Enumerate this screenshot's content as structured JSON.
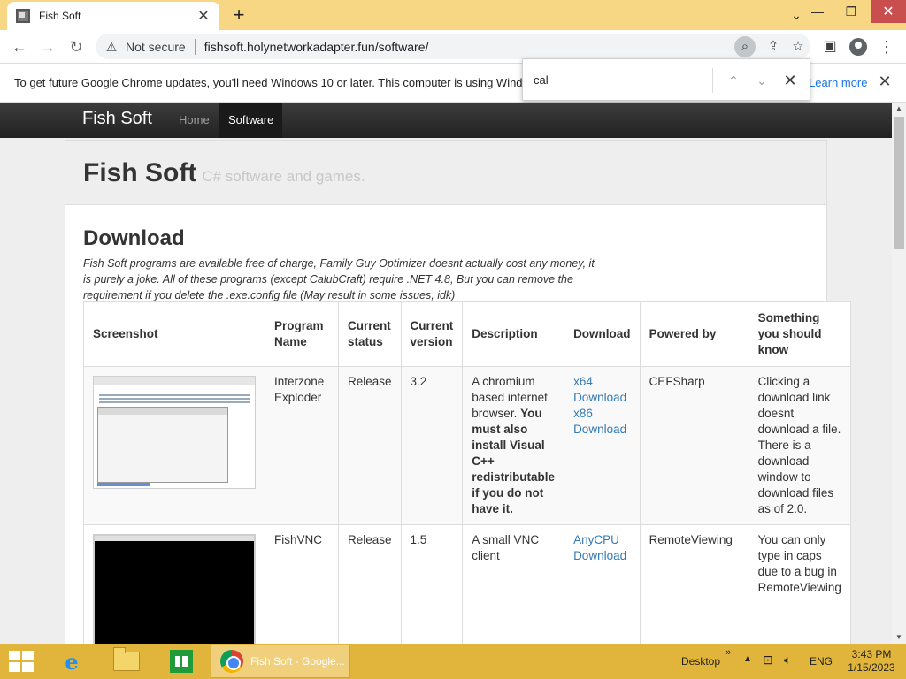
{
  "browser": {
    "tab_title": "Fish Soft",
    "tab_close": "✕",
    "new_tab": "+",
    "window_controls": {
      "dropdown": "⌄",
      "minimize": "—",
      "restore": "❐",
      "close": "✕"
    },
    "nav": {
      "back": "←",
      "forward": "→",
      "reload": "↻"
    },
    "security_label": "Not secure",
    "url": "fishsoft.holynetworkadapter.fun/software/",
    "infobar": {
      "text": "To get future Google Chrome updates, you'll need Windows 10 or later. This computer is using Windows 8.",
      "link": "Learn more"
    },
    "find": {
      "query": "cal",
      "prev": "⌃",
      "next": "⌄",
      "close": "✕"
    }
  },
  "site": {
    "brand": "Fish Soft",
    "nav": [
      {
        "label": "Home"
      },
      {
        "label": "Software"
      }
    ],
    "jumbo_title": "Fish Soft",
    "jumbo_subtitle": "C# software and games.",
    "section_title": "Download",
    "section_desc": "Fish Soft programs are available free of charge, Family Guy Optimizer doesnt actually cost any money, it is purely a joke. All of these programs (except CalubCraft) require .NET 4.8, But you can remove the requirement if you delete the .exe.config file (May result in some issues, idk)",
    "table": {
      "headers": [
        "Screenshot",
        "Program Name",
        "Current status",
        "Current version",
        "Description",
        "Download",
        "Powered by",
        "Something you should know"
      ],
      "rows": [
        {
          "name": "Interzone Exploder",
          "status": "Release",
          "version": "3.2",
          "desc_plain": "A chromium based internet browser.",
          "desc_bold": "You must also install Visual C++ redistributable if you do not have it.",
          "downloads": [
            "x64 Download",
            "x86 Download"
          ],
          "powered_by": "CEFSharp",
          "note": "Clicking a download link doesnt download a file. There is a download window to download files as of 2.0."
        },
        {
          "name": "FishVNC",
          "status": "Release",
          "version": "1.5",
          "desc_plain": "A small VNC client",
          "desc_bold": "",
          "downloads": [
            "AnyCPU Download"
          ],
          "powered_by": "RemoteViewing",
          "note": "You can only type in caps due to a bug in RemoteViewing"
        }
      ]
    }
  },
  "taskbar": {
    "chrome_label": "Fish Soft - Google...",
    "desktop_label": "Desktop",
    "language": "ENG",
    "time": "3:43 PM",
    "date": "1/15/2023"
  }
}
